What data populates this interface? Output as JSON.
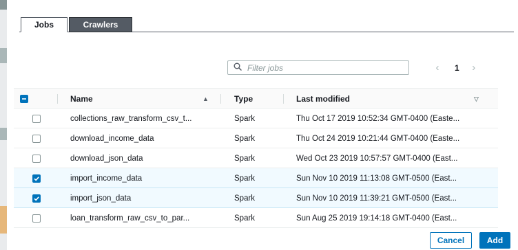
{
  "tabs": [
    {
      "label": "Jobs",
      "active": true
    },
    {
      "label": "Crawlers",
      "active": false
    }
  ],
  "filter": {
    "placeholder": "Filter jobs",
    "value": ""
  },
  "pagination": {
    "current_page": "1",
    "prev_icon": "chevron-left-icon",
    "next_icon": "chevron-right-icon"
  },
  "table": {
    "columns": [
      "Name",
      "Type",
      "Last modified"
    ],
    "header_checkbox": "indeterminate",
    "rows": [
      {
        "name": "collections_raw_transform_csv_t...",
        "type": "Spark",
        "last_modified": "Thu Oct 17 2019 10:52:34 GMT-0400 (Easte...",
        "checked": false
      },
      {
        "name": "download_income_data",
        "type": "Spark",
        "last_modified": "Thu Oct 24 2019 10:21:44 GMT-0400 (Easte...",
        "checked": false
      },
      {
        "name": "download_json_data",
        "type": "Spark",
        "last_modified": "Wed Oct 23 2019 10:57:57 GMT-0400 (East...",
        "checked": false
      },
      {
        "name": "import_income_data",
        "type": "Spark",
        "last_modified": "Sun Nov 10 2019 11:13:08 GMT-0500 (East...",
        "checked": true
      },
      {
        "name": "import_json_data",
        "type": "Spark",
        "last_modified": "Sun Nov 10 2019 11:39:21 GMT-0500 (East...",
        "checked": true
      },
      {
        "name": "loan_transform_raw_csv_to_par...",
        "type": "Spark",
        "last_modified": "Sun Aug 25 2019 19:14:18 GMT-0400 (East...",
        "checked": false
      }
    ]
  },
  "footer": {
    "cancel_label": "Cancel",
    "add_label": "Add"
  },
  "colors": {
    "accent": "#0073bb",
    "selected_row": "#f1faff",
    "tab_dark": "#545b64"
  }
}
